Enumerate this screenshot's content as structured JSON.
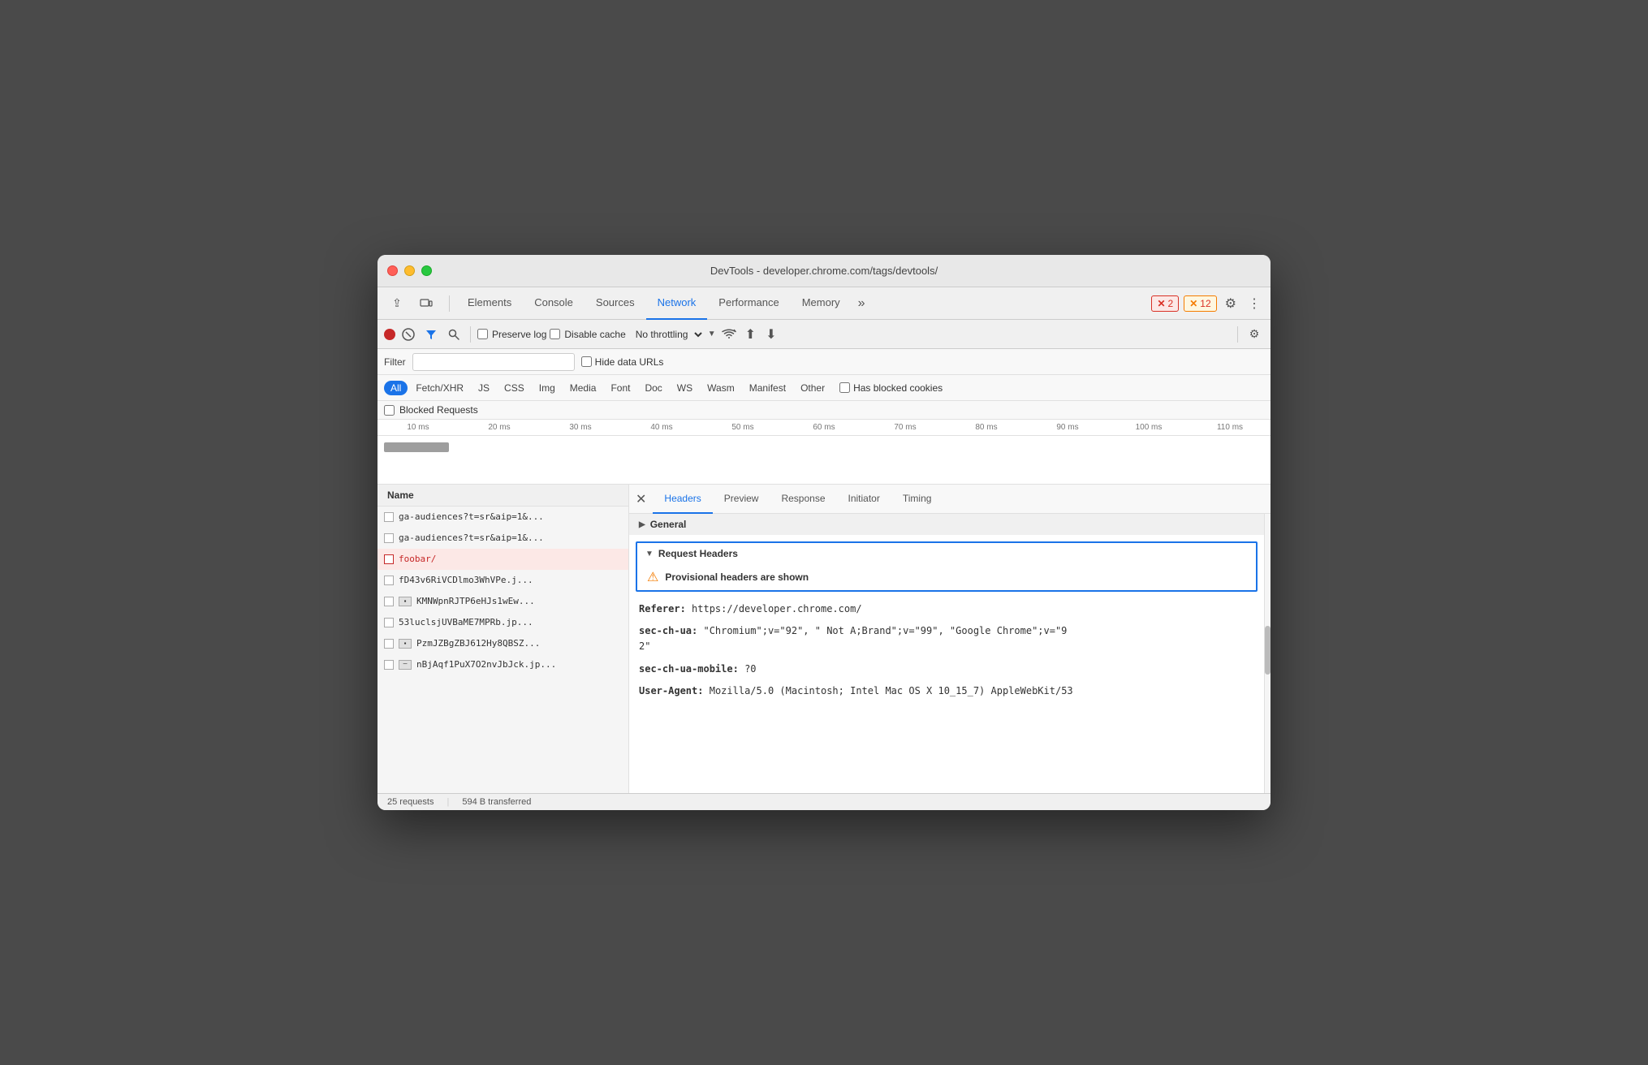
{
  "titlebar": {
    "title": "DevTools - developer.chrome.com/tags/devtools/"
  },
  "tabs": {
    "items": [
      {
        "label": "Elements",
        "active": false
      },
      {
        "label": "Console",
        "active": false
      },
      {
        "label": "Sources",
        "active": false
      },
      {
        "label": "Network",
        "active": true
      },
      {
        "label": "Performance",
        "active": false
      },
      {
        "label": "Memory",
        "active": false
      }
    ],
    "more_label": "»",
    "error_count": "2",
    "warning_count": "12"
  },
  "toolbar": {
    "preserve_log": "Preserve log",
    "disable_cache": "Disable cache",
    "throttling": "No throttling"
  },
  "filter": {
    "label": "Filter",
    "hide_data_urls": "Hide data URLs"
  },
  "type_filters": [
    "All",
    "Fetch/XHR",
    "JS",
    "CSS",
    "Img",
    "Media",
    "Font",
    "Doc",
    "WS",
    "Wasm",
    "Manifest",
    "Other"
  ],
  "has_blocked_cookies": "Has blocked cookies",
  "blocked_requests": "Blocked Requests",
  "timeline": {
    "ticks": [
      "10 ms",
      "20 ms",
      "30 ms",
      "40 ms",
      "50 ms",
      "60 ms",
      "70 ms",
      "80 ms",
      "90 ms",
      "100 ms",
      "110 ms"
    ]
  },
  "request_list": {
    "header": "Name",
    "items": [
      {
        "name": "ga-audiences?t=sr&aip=1&...",
        "type": "normal",
        "selected": false
      },
      {
        "name": "ga-audiences?t=sr&aip=1&...",
        "type": "normal",
        "selected": false
      },
      {
        "name": "foobar/",
        "type": "error",
        "selected": true
      },
      {
        "name": "fD43v6RiVCDlmo3WhVPe.j...",
        "type": "normal",
        "selected": false
      },
      {
        "name": "KMNWpnRJTP6eHJs1wEw...",
        "type": "img",
        "selected": false
      },
      {
        "name": "53luclsjUVBaME7MPRb.jp...",
        "type": "normal",
        "selected": false
      },
      {
        "name": "PzmJZBgZBJ612Hy8QBSZ...",
        "type": "img",
        "selected": false
      },
      {
        "name": "nBjAqf1PuX7O2nvJbJck.jp...",
        "type": "minus",
        "selected": false
      }
    ]
  },
  "detail_tabs": {
    "items": [
      "Headers",
      "Preview",
      "Response",
      "Initiator",
      "Timing"
    ],
    "active": "Headers"
  },
  "detail": {
    "general_label": "General",
    "request_headers_label": "Request Headers",
    "provisional_warning": "Provisional headers are shown",
    "headers": [
      {
        "key": "Referer:",
        "value": "https://developer.chrome.com/"
      },
      {
        "key": "sec-ch-ua:",
        "value": "\"Chromium\";v=\"92\", \" Not A;Brand\";v=\"99\", \"Google Chrome\";v=\"92\""
      },
      {
        "key": "sec-ch-ua-mobile:",
        "value": "?0"
      },
      {
        "key": "User-Agent:",
        "value": "Mozilla/5.0 (Macintosh; Intel Mac OS X 10_15_7) AppleWebKit/53"
      }
    ]
  },
  "statusbar": {
    "requests": "25 requests",
    "transferred": "594 B transferred"
  }
}
